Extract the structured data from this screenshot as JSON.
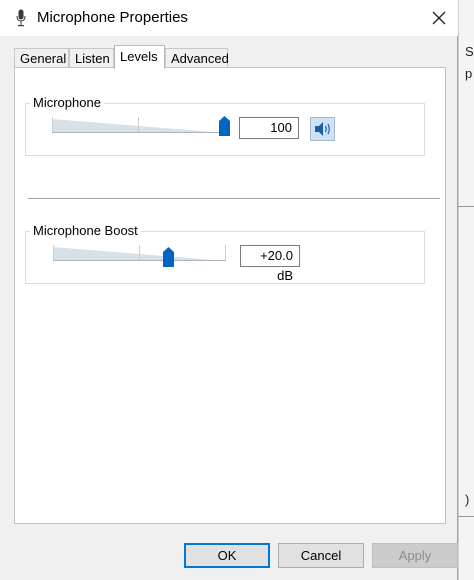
{
  "window": {
    "title": "Microphone Properties"
  },
  "tabs": [
    {
      "label": "General",
      "active": false
    },
    {
      "label": "Listen",
      "active": false
    },
    {
      "label": "Levels",
      "active": true
    },
    {
      "label": "Advanced",
      "active": false
    }
  ],
  "levels": {
    "microphone": {
      "label": "Microphone",
      "value": "100",
      "level_percent": 100
    },
    "boost": {
      "label": "Microphone Boost",
      "value": "+20.0 dB",
      "level_fraction": 0.667
    }
  },
  "buttons": {
    "ok": "OK",
    "cancel": "Cancel",
    "apply": "Apply"
  },
  "background": {
    "fragments": [
      "S",
      "p",
      ")"
    ]
  },
  "colors": {
    "accent": "#0078d7",
    "thumb": "#0067c0",
    "dialog_bg": "#f0f0f0"
  }
}
